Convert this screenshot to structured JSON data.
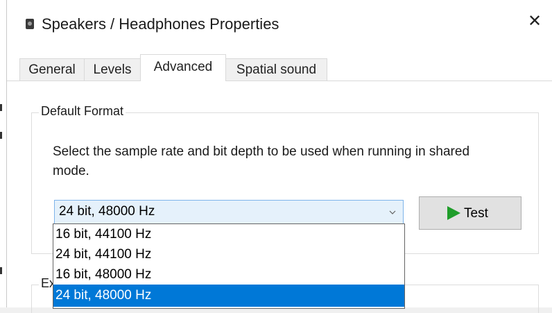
{
  "window": {
    "title": "Speakers / Headphones Properties",
    "close_glyph": "✕",
    "icon": "speaker-icon"
  },
  "tabs": [
    {
      "label": "General"
    },
    {
      "label": "Levels"
    },
    {
      "label": "Advanced",
      "active": true
    },
    {
      "label": "Spatial sound"
    }
  ],
  "default_format": {
    "group_label": "Default Format",
    "description": "Select the sample rate and bit depth to be used when running in shared mode.",
    "selected_value": "24 bit, 48000 Hz",
    "options": [
      "16 bit, 44100 Hz",
      "24 bit, 44100 Hz",
      "16 bit, 48000 Hz",
      "24 bit, 48000 Hz"
    ],
    "highlighted_index": 3,
    "test_button": {
      "label": "Test",
      "icon": "play-icon"
    }
  },
  "exclusive_mode": {
    "group_label_partial": "Ex"
  },
  "colors": {
    "selection": "#0078d7",
    "combo_focus_border": "#7eb4ea",
    "play_icon": "#1f9d2a"
  }
}
